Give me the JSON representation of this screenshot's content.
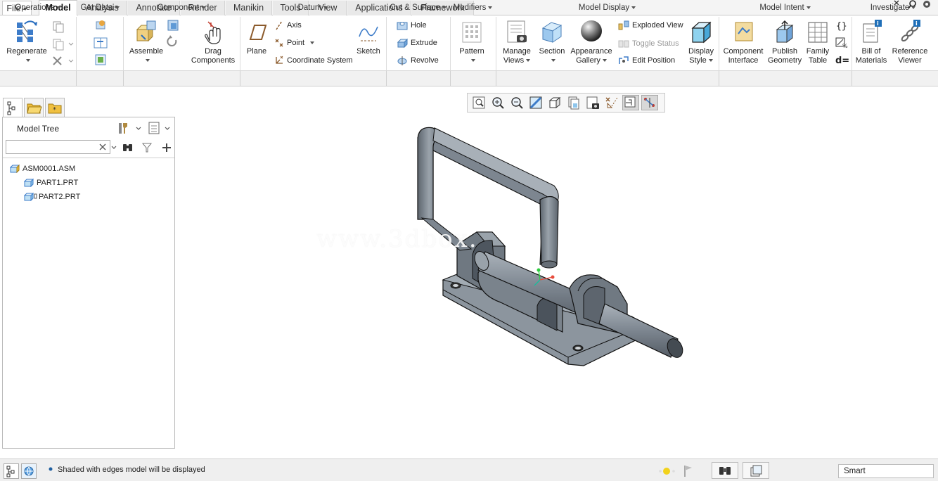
{
  "tabs": [
    "File",
    "Model",
    "Analysis",
    "Annotate",
    "Render",
    "Manikin",
    "Tools",
    "View",
    "Applications",
    "Framework"
  ],
  "active_tab": "Model",
  "ribbon": {
    "regenerate": "Regenerate",
    "assemble": "Assemble",
    "drag_components": "Drag Components",
    "plane": "Plane",
    "axis": "Axis",
    "point": "Point",
    "coordinate_system": "Coordinate System",
    "sketch": "Sketch",
    "hole": "Hole",
    "extrude": "Extrude",
    "revolve": "Revolve",
    "pattern": "Pattern",
    "manage_views": "Manage Views",
    "section": "Section",
    "appearance_gallery": "Appearance Gallery",
    "exploded_view": "Exploded View",
    "toggle_status": "Toggle Status",
    "edit_position": "Edit Position",
    "display_style": "Display Style",
    "component_interface": "Component Interface",
    "publish_geometry": "Publish Geometry",
    "family_table": "Family Table",
    "bill_of_materials": "Bill of Materials",
    "reference_viewer": "Reference Viewer"
  },
  "groups": [
    "Operations",
    "Get Data",
    "Component",
    "Datum",
    "Cut & Surface",
    "Modifiers",
    "Model Display",
    "Model Intent",
    "Investigate"
  ],
  "model_tree": {
    "title": "Model Tree",
    "search_value": "",
    "root": "ASM0001.ASM",
    "parts": [
      "PART1.PRT",
      "PART2.PRT"
    ]
  },
  "watermark": "www.3dbox.",
  "status": {
    "message": "Shaded with edges model will be displayed",
    "selection_filter": "Smart"
  },
  "colors": {
    "model_fill": "#7d8690",
    "model_dark": "#5f6770",
    "model_light": "#a8b0b8",
    "edge": "#111111",
    "accent_blue": "#2a7fc8"
  }
}
